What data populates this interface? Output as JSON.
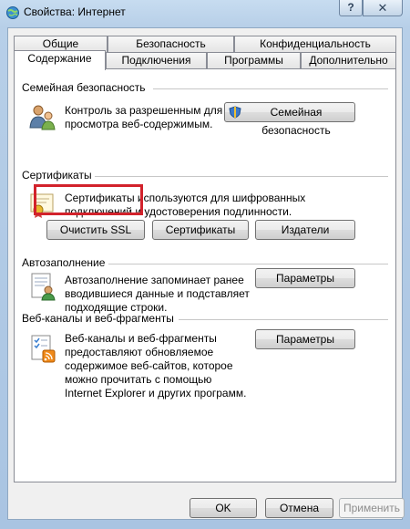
{
  "window": {
    "title": "Свойства: Интернет",
    "help_label": "?",
    "close_label": "✕"
  },
  "tabs": {
    "row1": [
      "Общие",
      "Безопасность",
      "Конфиденциальность"
    ],
    "row2": [
      "Содержание",
      "Подключения",
      "Программы",
      "Дополнительно"
    ],
    "active": "Содержание"
  },
  "family": {
    "title": "Семейная безопасность",
    "desc_line1": "Контроль за разрешенным для",
    "desc_line2": "просмотра веб-содержимым.",
    "button": "Семейная безопасность"
  },
  "certificates": {
    "title": "Сертификаты",
    "desc_line1": "Сертификаты используются для шифрованных",
    "desc_line2": "подключений и удостоверения подлинности.",
    "buttons": [
      "Очистить SSL",
      "Сертификаты",
      "Издатели"
    ]
  },
  "autocomplete": {
    "title": "Автозаполнение",
    "desc_line1": "Автозаполнение запоминает ранее",
    "desc_line2": "вводившиеся данные и подставляет",
    "desc_line3": "подходящие строки.",
    "button": "Параметры"
  },
  "feeds": {
    "title": "Веб-каналы и веб-фрагменты",
    "desc_line1": "Веб-каналы и веб-фрагменты",
    "desc_line2": "предоставляют обновляемое",
    "desc_line3": "содержимое веб-сайтов, которое",
    "desc_line4": "можно прочитать с помощью",
    "desc_line5": "Internet Explorer и других программ.",
    "button": "Параметры"
  },
  "footer": {
    "ok": "OK",
    "cancel": "Отмена",
    "apply": "Применить"
  },
  "colors": {
    "highlight": "#d2222b"
  }
}
